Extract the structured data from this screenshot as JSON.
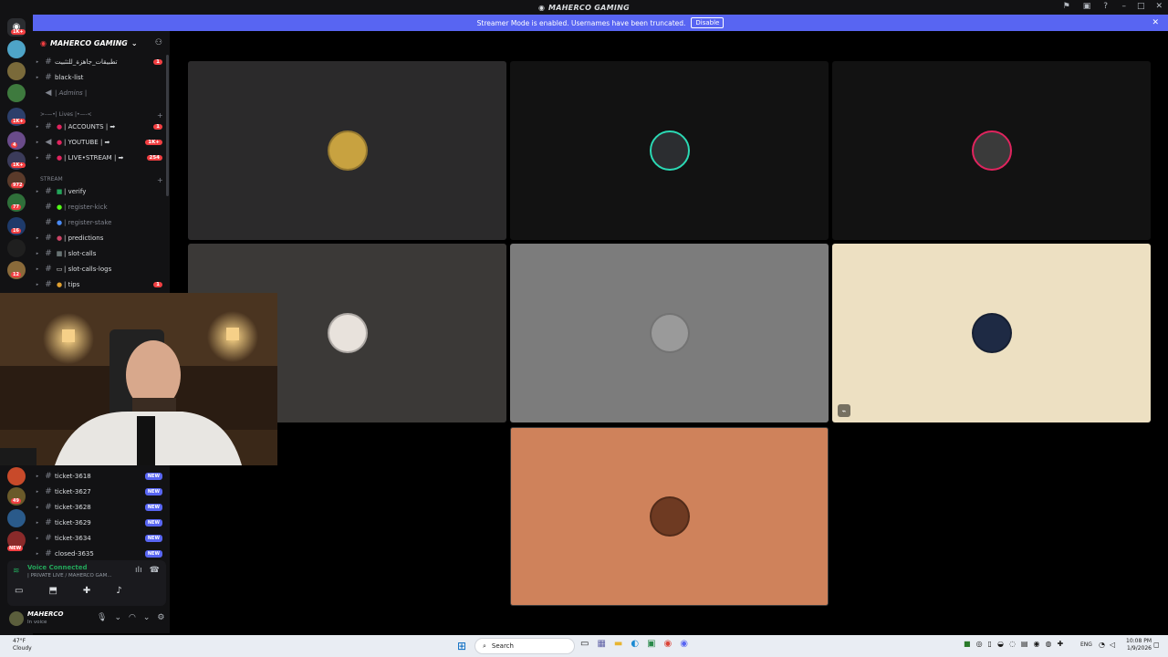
{
  "window": {
    "title": "MAHERCO GAMING"
  },
  "banner": {
    "text": "Streamer Mode is enabled. Usernames have been truncated.",
    "disable": "Disable"
  },
  "rail": {
    "badges": [
      "1K+",
      "1K+",
      "4",
      "1K+",
      "49",
      "972",
      "77",
      "16",
      "12",
      "NEW"
    ]
  },
  "server": {
    "name": "MAHERCO GAMING"
  },
  "channels": {
    "top": [
      {
        "name": "تطبيقات_جاهزة_للتثبيت",
        "badge": "1"
      },
      {
        "name": "black-list"
      },
      {
        "name": "| Admins |"
      }
    ],
    "lives_category": ">-—•| Lives |•—-<",
    "lives": [
      {
        "name": "| ACCOUNTS | ➡",
        "badge": "1"
      },
      {
        "name": "| YOUTUBE | ➡",
        "badge": "1K+"
      },
      {
        "name": "| LIVE•STREAM | ➡",
        "badge": "254"
      }
    ],
    "stream_category": "STREAM",
    "stream": [
      {
        "name": "| verify"
      },
      {
        "name": "| register-kick"
      },
      {
        "name": "| register-stake"
      },
      {
        "name": "| predictions"
      },
      {
        "name": "| slot-calls"
      },
      {
        "name": "| slot-calls-logs"
      },
      {
        "name": "| tips",
        "badge": "1"
      }
    ],
    "tickets": [
      {
        "name": "ticket-3618",
        "new": "NEW"
      },
      {
        "name": "ticket-3627",
        "new": "NEW"
      },
      {
        "name": "ticket-3628",
        "new": "NEW"
      },
      {
        "name": "ticket-3629",
        "new": "NEW"
      },
      {
        "name": "ticket-3634",
        "new": "NEW"
      },
      {
        "name": "closed-3635",
        "new": "NEW"
      }
    ]
  },
  "voice": {
    "status": "Voice Connected",
    "channel": "| PRIVATE LIVE / MAHERCO GAM..."
  },
  "user": {
    "name": "MAHERCO",
    "status": "In voice"
  },
  "tiles": [
    {
      "bg": "#2b2a2b",
      "avatar": "#c8a240"
    },
    {
      "bg": "#121212",
      "avatar": "#2b2d30"
    },
    {
      "bg": "#121212",
      "avatar": "#3a3a3a"
    },
    {
      "bg": "#3b3937",
      "avatar": "#e8e2dc"
    },
    {
      "bg": "#7c7c7c",
      "avatar": "#9a9a9a"
    },
    {
      "bg": "#ede0c2",
      "avatar": "#1e2a44"
    },
    {
      "bg": "#cf825b",
      "avatar": "#6e3a22"
    }
  ],
  "taskbar": {
    "temp": "47°F",
    "weather": "Cloudy",
    "search": "Search",
    "lang": "ENG",
    "time": "10:08 PM",
    "date": "1/9/2026"
  }
}
